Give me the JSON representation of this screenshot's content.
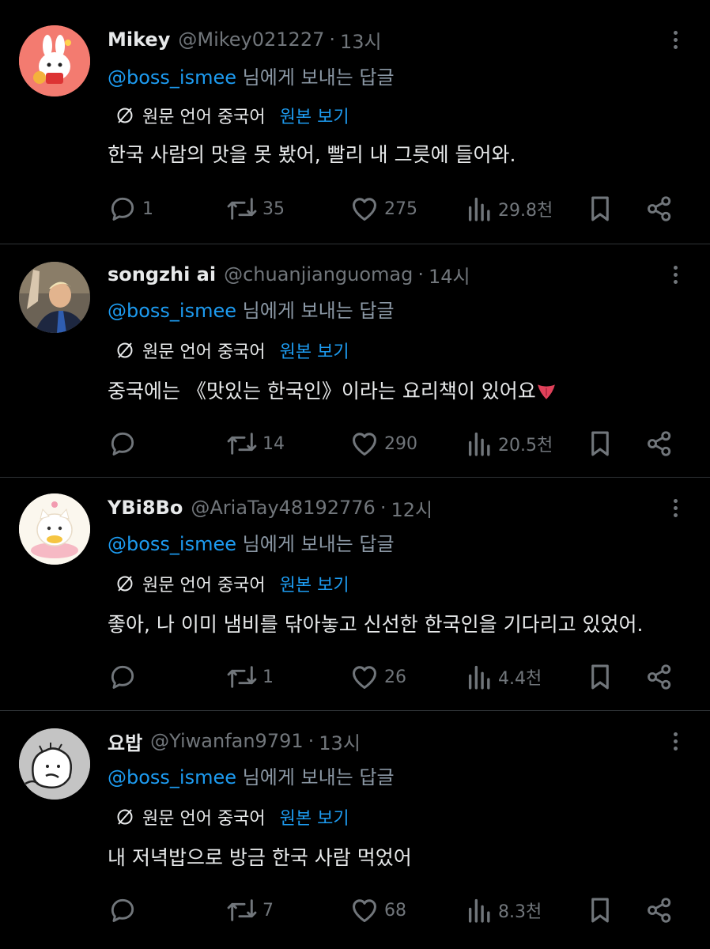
{
  "colors": {
    "background": "#000000",
    "text": "#e7e9ea",
    "muted": "#71767b",
    "accent": "#1d9bf0",
    "divider": "#2f3336"
  },
  "tweets": [
    {
      "name": "Mikey",
      "handle": "@Mikey021227",
      "time": "13시",
      "reply_mention": "@boss_ismee",
      "reply_suffix": "님에게 보내는 답글",
      "translation_label": "원문 언어 중국어",
      "translation_link": "원본 보기",
      "text": "한국 사람의 맛을 못 봤어, 빨리 내 그릇에 들어와.",
      "replies": "1",
      "retweets": "35",
      "likes": "275",
      "views": "29.8천",
      "avatar_icon": "cartoon-rabbit-avatar"
    },
    {
      "name": "songzhi ai",
      "handle": "@chuanjianguomag",
      "time": "14시",
      "reply_mention": "@boss_ismee",
      "reply_suffix": "님에게 보내는 답글",
      "translation_label": "원문 언어 중국어",
      "translation_link": "원본 보기",
      "text": "중국에는 《맛있는 한국인》이라는 요리책이 있어요",
      "emoji": "tongue-emoji",
      "replies": "",
      "retweets": "14",
      "likes": "290",
      "views": "20.5천",
      "avatar_icon": "person-photo-avatar"
    },
    {
      "name": "YBi8Bo",
      "handle": "@AriaTay48192776",
      "time": "12시",
      "reply_mention": "@boss_ismee",
      "reply_suffix": "님에게 보내는 답글",
      "translation_label": "원문 언어 중국어",
      "translation_link": "원본 보기",
      "text": "좋아, 나 이미 냄비를 닦아놓고 신선한 한국인을 기다리고 있었어.",
      "replies": "",
      "retweets": "1",
      "likes": "26",
      "views": "4.4천",
      "avatar_icon": "cartoon-cat-avatar"
    },
    {
      "name": "요밥",
      "handle": "@Yiwanfan9791",
      "time": "13시",
      "reply_mention": "@boss_ismee",
      "reply_suffix": "님에게 보내는 답글",
      "translation_label": "원문 언어 중국어",
      "translation_link": "원본 보기",
      "text": "내 저녁밥으로 방금 한국 사람 먹었어",
      "replies": "",
      "retweets": "7",
      "likes": "68",
      "views": "8.3천",
      "avatar_icon": "doodle-face-avatar"
    }
  ]
}
